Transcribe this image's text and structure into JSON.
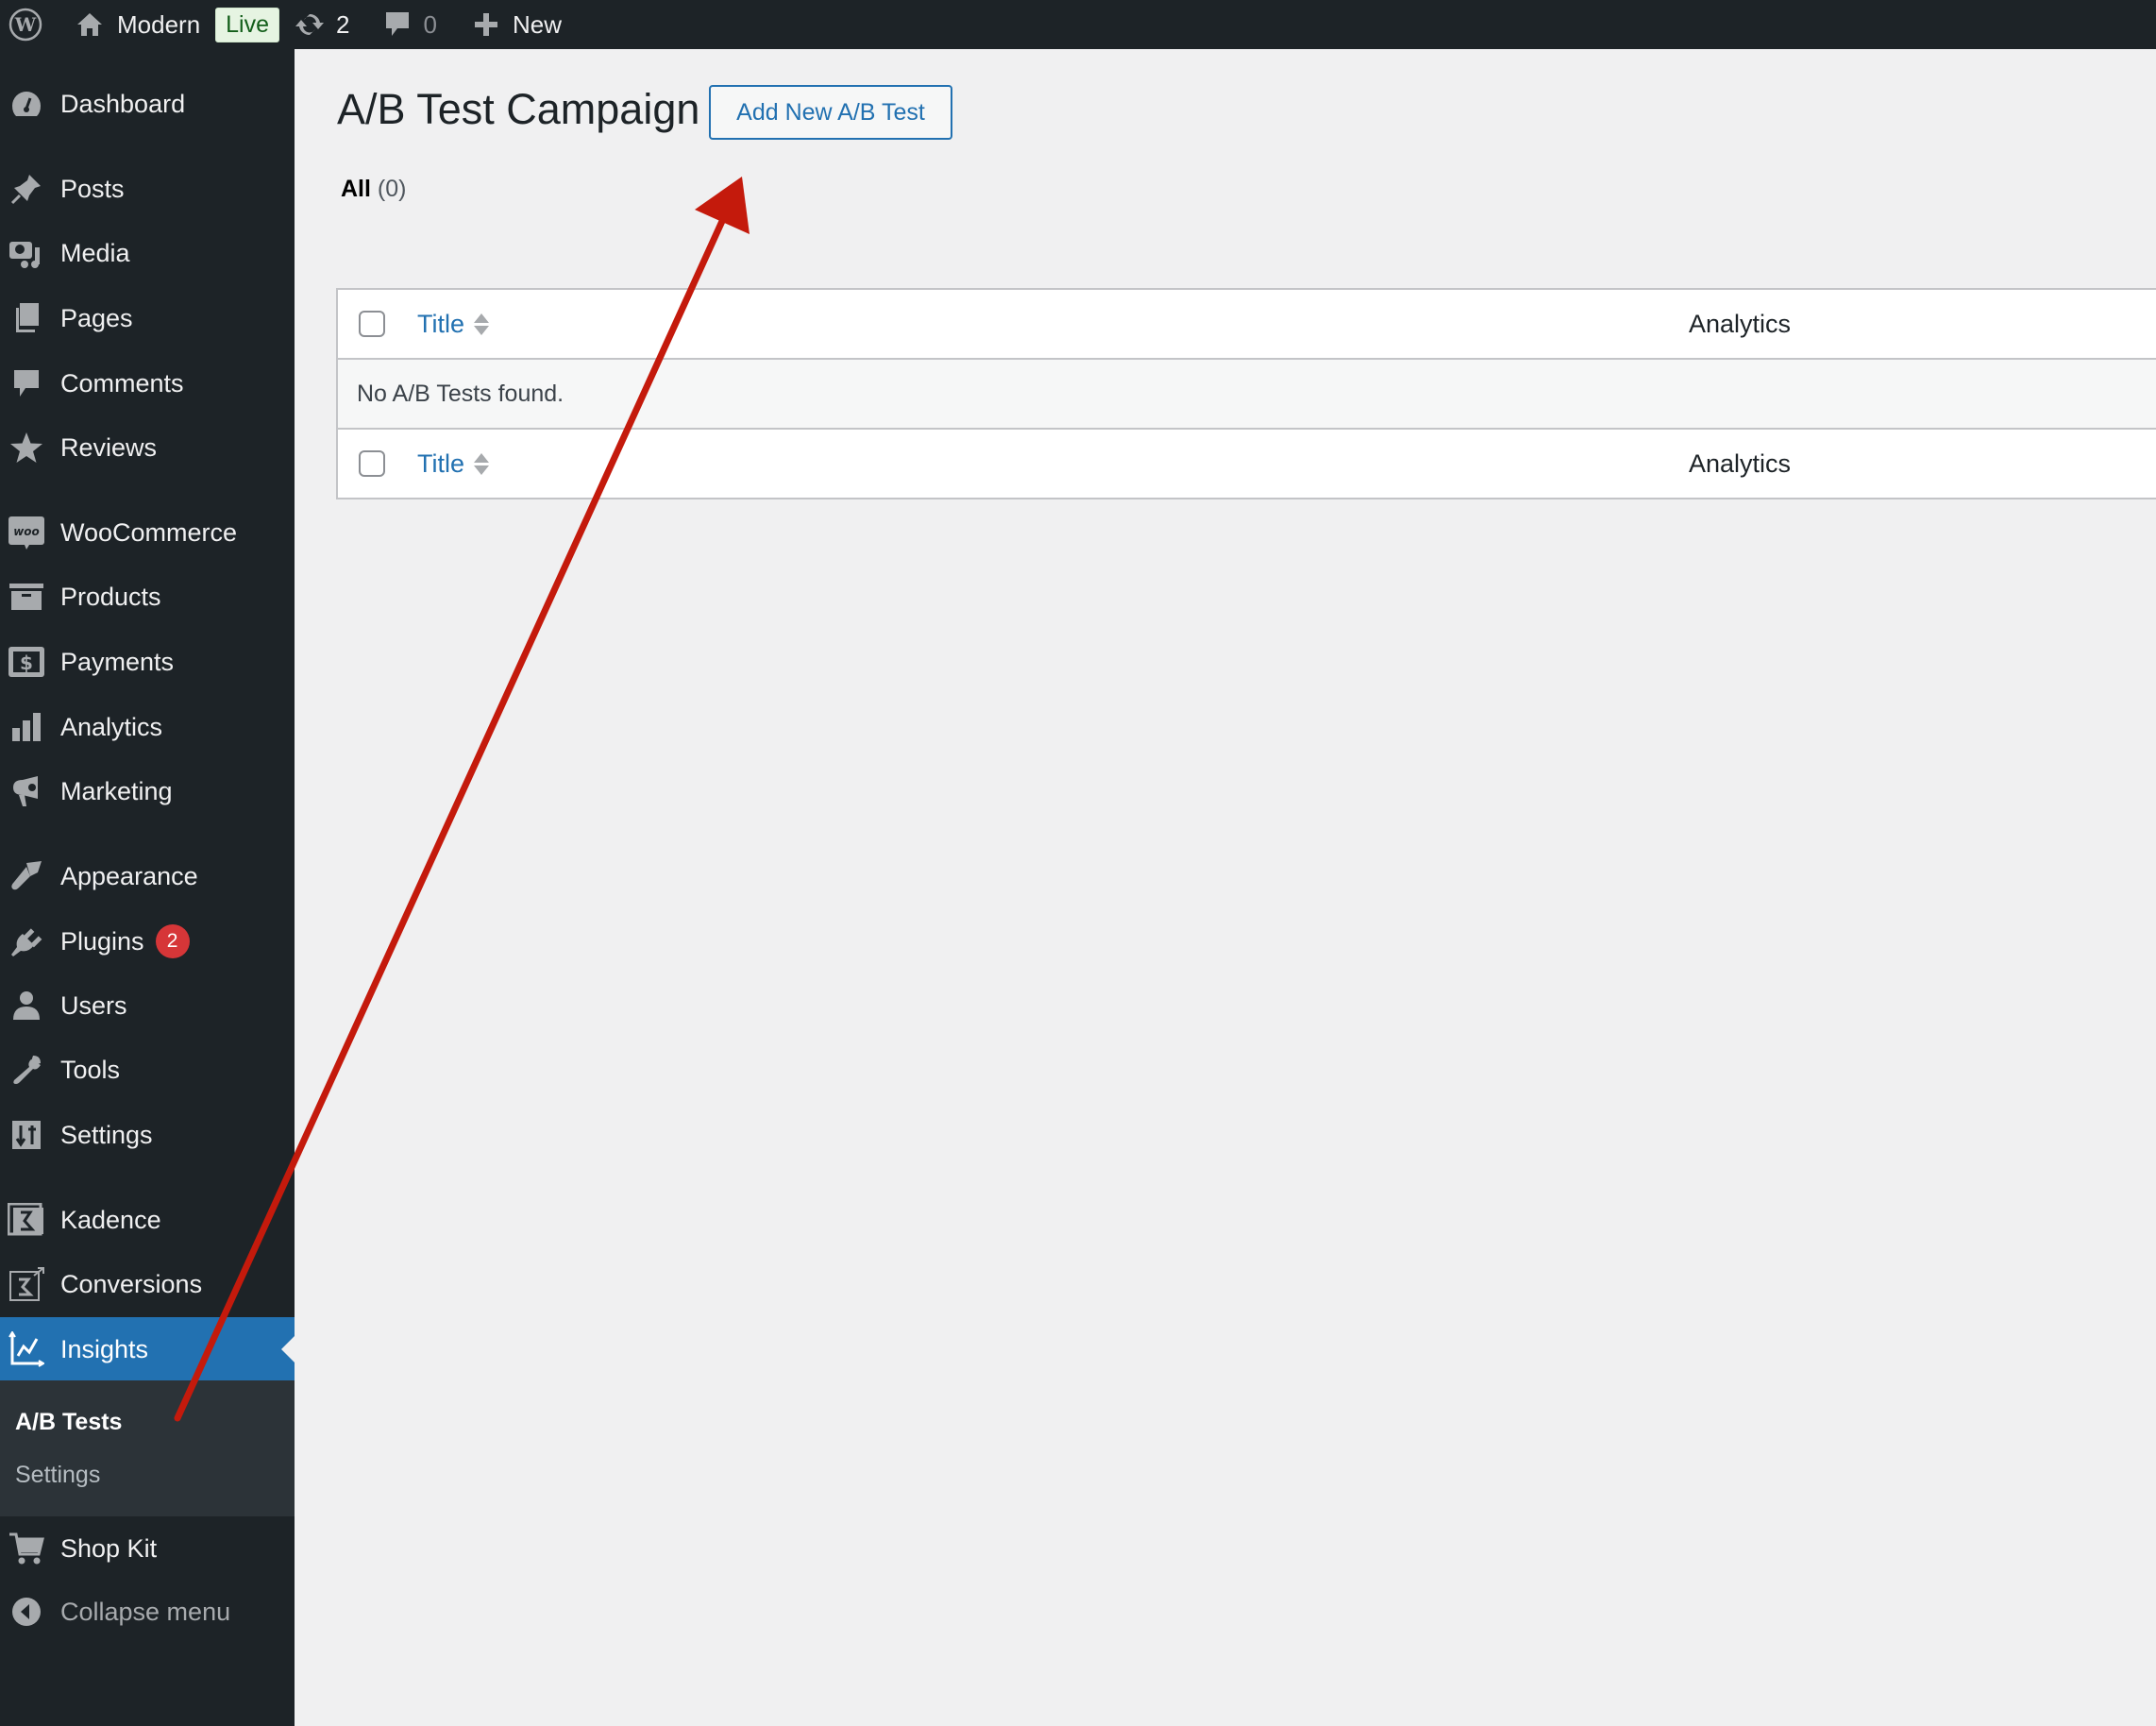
{
  "admin_bar": {
    "wp_logo_icon": "wordpress-logo-icon",
    "site_name": "Modern",
    "site_icon": "home-icon",
    "status_badge": "Live",
    "updates_icon": "refresh-icon",
    "updates_count": "2",
    "comments_icon": "comment-bubble-icon",
    "comments_count": "0",
    "new_icon": "plus-icon",
    "new_label": "New"
  },
  "sidebar": {
    "items": [
      {
        "label": "Dashboard",
        "icon": "dashboard-gauge-icon"
      },
      {
        "label": "Posts",
        "icon": "pushpin-icon"
      },
      {
        "label": "Media",
        "icon": "media-camera-music-icon"
      },
      {
        "label": "Pages",
        "icon": "pages-icon"
      },
      {
        "label": "Comments",
        "icon": "comment-icon"
      },
      {
        "label": "Reviews",
        "icon": "star-icon"
      },
      {
        "label": "WooCommerce",
        "icon": "woo-icon"
      },
      {
        "label": "Products",
        "icon": "archive-box-icon"
      },
      {
        "label": "Payments",
        "icon": "dollar-icon"
      },
      {
        "label": "Analytics",
        "icon": "bar-chart-icon"
      },
      {
        "label": "Marketing",
        "icon": "megaphone-icon"
      },
      {
        "label": "Appearance",
        "icon": "paintbrush-icon"
      },
      {
        "label": "Plugins",
        "icon": "plug-icon",
        "badge": "2"
      },
      {
        "label": "Users",
        "icon": "user-icon"
      },
      {
        "label": "Tools",
        "icon": "wrench-icon"
      },
      {
        "label": "Settings",
        "icon": "sliders-icon"
      },
      {
        "label": "Kadence",
        "icon": "kadence-icon"
      },
      {
        "label": "Conversions",
        "icon": "conversions-icon"
      },
      {
        "label": "Insights",
        "icon": "line-chart-icon",
        "current": true
      },
      {
        "label": "Shop Kit",
        "icon": "cart-icon"
      },
      {
        "label": "Collapse menu",
        "icon": "collapse-arrow-icon"
      }
    ],
    "submenu": [
      {
        "label": "A/B Tests",
        "active": true
      },
      {
        "label": "Settings",
        "active": false
      }
    ]
  },
  "main": {
    "page_title": "A/B Test Campaign",
    "add_new_label": "Add New A/B Test",
    "filter": {
      "label": "All",
      "count": "(0)"
    },
    "table": {
      "columns": [
        "Title",
        "Analytics"
      ],
      "empty_message": "No A/B Tests found."
    }
  },
  "annotation": {
    "arrow_color": "#c41a0c",
    "points_to": "Add New A/B Test button",
    "origin": "A/B Tests submenu item"
  },
  "colors": {
    "admin_bar_bg": "#1d2327",
    "accent": "#2271b1",
    "page_bg": "#f0f0f1",
    "badge_red": "#d63638"
  }
}
